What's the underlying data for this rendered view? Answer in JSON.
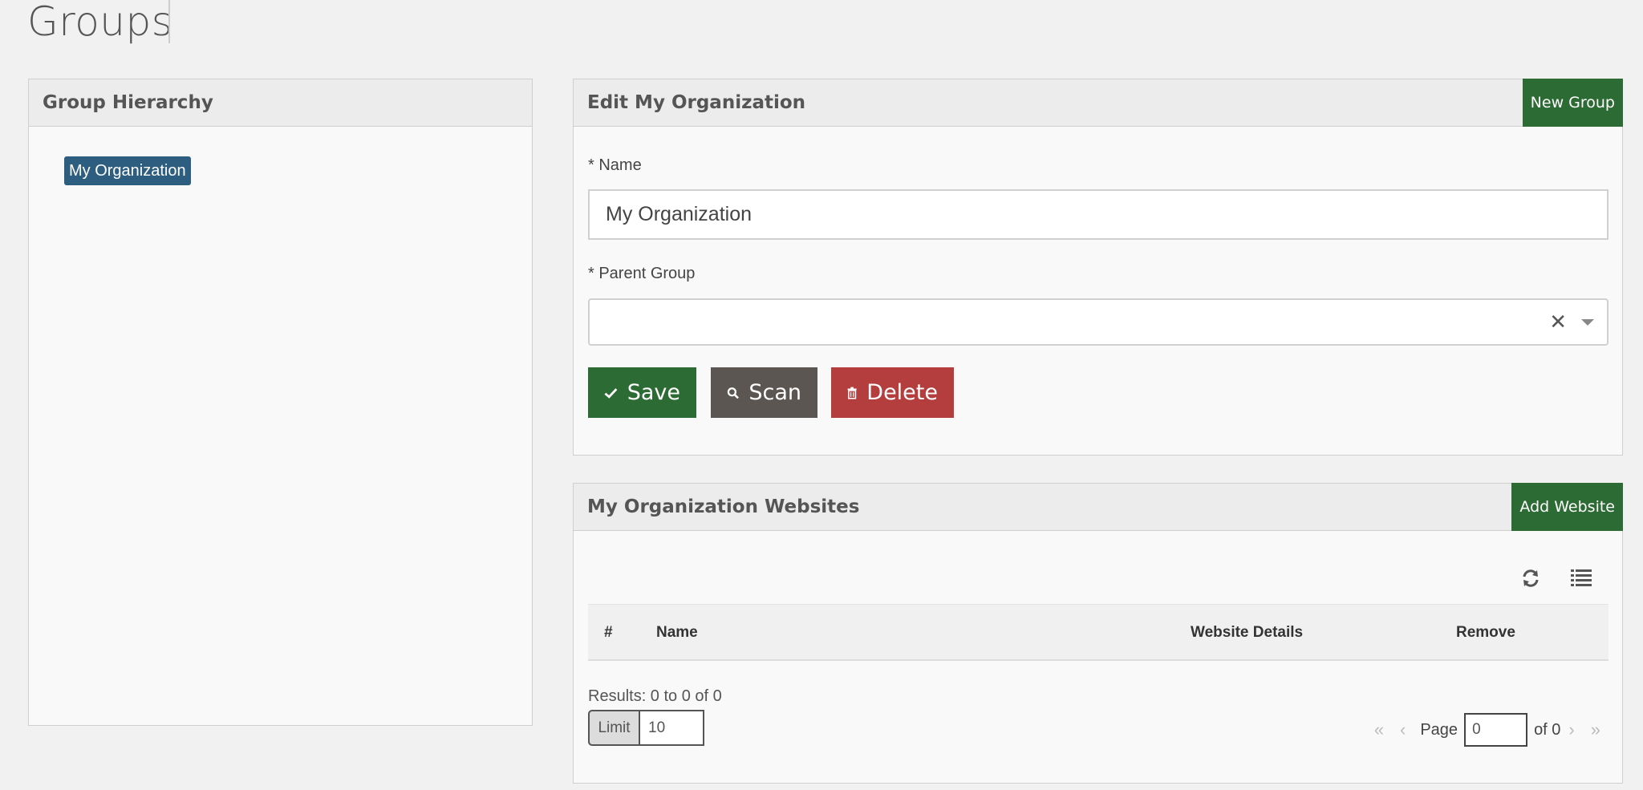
{
  "page": {
    "title": "Groups"
  },
  "hierarchy": {
    "title": "Group Hierarchy",
    "nodes": [
      "My Organization"
    ]
  },
  "edit": {
    "title": "Edit My Organization",
    "new_group_label": "New Group",
    "name_label": "* Name",
    "name_value": "My Organization",
    "parent_label": "* Parent Group",
    "parent_value": "",
    "clear_glyph": "✕",
    "save_label": "Save",
    "scan_label": "Scan",
    "delete_label": "Delete"
  },
  "websites": {
    "title": "My Organization Websites",
    "add_label": "Add Website",
    "columns": [
      "#",
      "Name",
      "Website Details",
      "Remove"
    ],
    "rows": [],
    "results_text": "Results: 0 to 0 of 0",
    "limit_label": "Limit",
    "limit_value": "10",
    "page_label": "Page",
    "page_value": "0",
    "of_label": "of 0",
    "nav": {
      "first": "«",
      "prev": "‹",
      "next": "›",
      "last": "»"
    }
  },
  "colors": {
    "primary_green": "#2c6b33",
    "scan_gray": "#5c5652",
    "delete_red": "#b43d3d",
    "node_blue": "#2d5e80"
  }
}
